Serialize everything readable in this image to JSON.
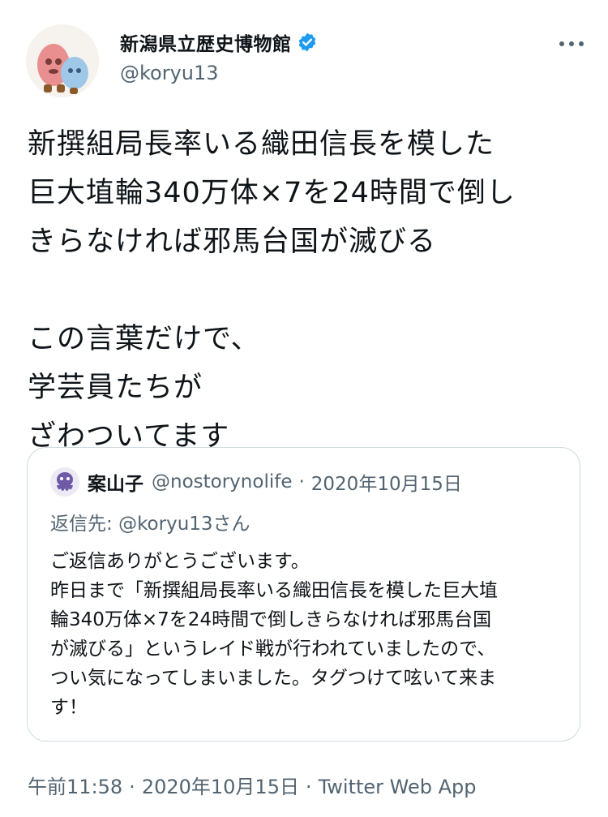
{
  "author": {
    "name": "新潟県立歴史博物館",
    "handle": "@koryu13",
    "verified_icon": "verified-badge-icon",
    "accent": "#1d9bf0"
  },
  "more_icon": "more-dots-icon",
  "tweet": {
    "text": "新撰組局長率いる織田信長を模した\n巨大埴輪340万体×7を24時間で倒し\nきらなければ邪馬台国が滅びる\n\nこの言葉だけで、\n学芸員たちが\nざわついてます"
  },
  "quote": {
    "name": "案山子",
    "handle": "@nostorynolife",
    "separator": "·",
    "date": "2020年10月15日",
    "reply_label": "返信先: ",
    "reply_to": "@koryu13さん",
    "text": "ご返信ありがとうございます。\n昨日まで「新撰組局長率いる織田信長を模した巨大埴\n輪340万体×7を24時間で倒しきらなければ邪馬台国\nが滅びる」というレイド戦が行われていましたので、\nつい気になってしまいました。タグつけて呟いて来ま\nす！"
  },
  "meta": {
    "time": "午前11:58",
    "separator": "·",
    "date": "2020年10月15日",
    "source": "Twitter Web App"
  }
}
